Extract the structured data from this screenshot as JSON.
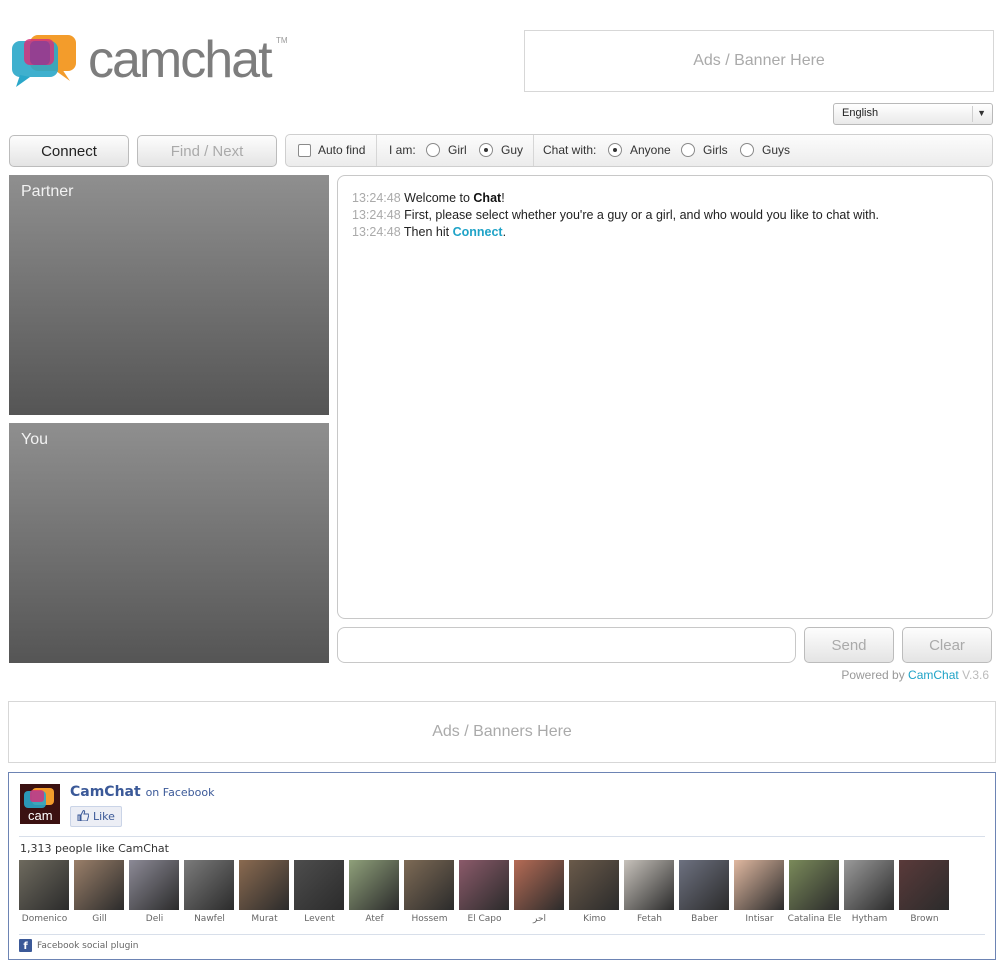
{
  "header": {
    "logo_text": "camchat",
    "logo_tm": "TM",
    "ad_top": "Ads / Banner Here",
    "language": "English"
  },
  "toolbar": {
    "connect": "Connect",
    "find_next": "Find / Next",
    "auto_find": "Auto find",
    "i_am": "I am:",
    "girl": "Girl",
    "guy": "Guy",
    "chat_with": "Chat with:",
    "anyone": "Anyone",
    "girls": "Girls",
    "guys": "Guys",
    "auto_find_checked": false,
    "i_am_selected": "Guy",
    "chat_with_selected": "Anyone"
  },
  "video": {
    "partner": "Partner",
    "you": "You"
  },
  "chat": {
    "messages": [
      {
        "ts": "13:24:48",
        "pre": "Welcome to ",
        "bold": "Chat",
        "post": "!"
      },
      {
        "ts": "13:24:48",
        "text": "First, please select whether you're a guy or a girl, and who would you like to chat with."
      },
      {
        "ts": "13:24:48",
        "pre": "Then hit ",
        "link": "Connect",
        "post": "."
      }
    ],
    "send": "Send",
    "clear": "Clear"
  },
  "footer": {
    "powered_by": "Powered by",
    "brand": "CamChat",
    "version": "V.3.6",
    "ad_bottom": "Ads / Banners Here"
  },
  "facebook": {
    "page_name": "CamChat",
    "on_facebook": "on Facebook",
    "like": "Like",
    "count_text": "1,313 people like CamChat",
    "plugin": "Facebook social plugin",
    "logo_text": "cam",
    "faces": [
      {
        "name": "Domenico",
        "color": "#6e6a5e"
      },
      {
        "name": "Gill",
        "color": "#9a7f69"
      },
      {
        "name": "Deli",
        "color": "#8c8a96"
      },
      {
        "name": "Nawfel",
        "color": "#7b7b7b"
      },
      {
        "name": "Murat",
        "color": "#8a6a50"
      },
      {
        "name": "Levent",
        "color": "#4d4d4d"
      },
      {
        "name": "Atef",
        "color": "#8fa07a"
      },
      {
        "name": "Hossem",
        "color": "#7d6a55"
      },
      {
        "name": "El Capo",
        "color": "#8b5a6a"
      },
      {
        "name": "احر",
        "color": "#b56b55"
      },
      {
        "name": "Kimo",
        "color": "#6a5a4a"
      },
      {
        "name": "Fetah",
        "color": "#c7c2bb"
      },
      {
        "name": "Baber",
        "color": "#6d7180"
      },
      {
        "name": "Intisar",
        "color": "#e0b8a0"
      },
      {
        "name": "Catalina Ele",
        "color": "#7a8a5a"
      },
      {
        "name": "Hytham",
        "color": "#9a9a9a"
      },
      {
        "name": "Brown",
        "color": "#5a3a3a"
      }
    ]
  }
}
